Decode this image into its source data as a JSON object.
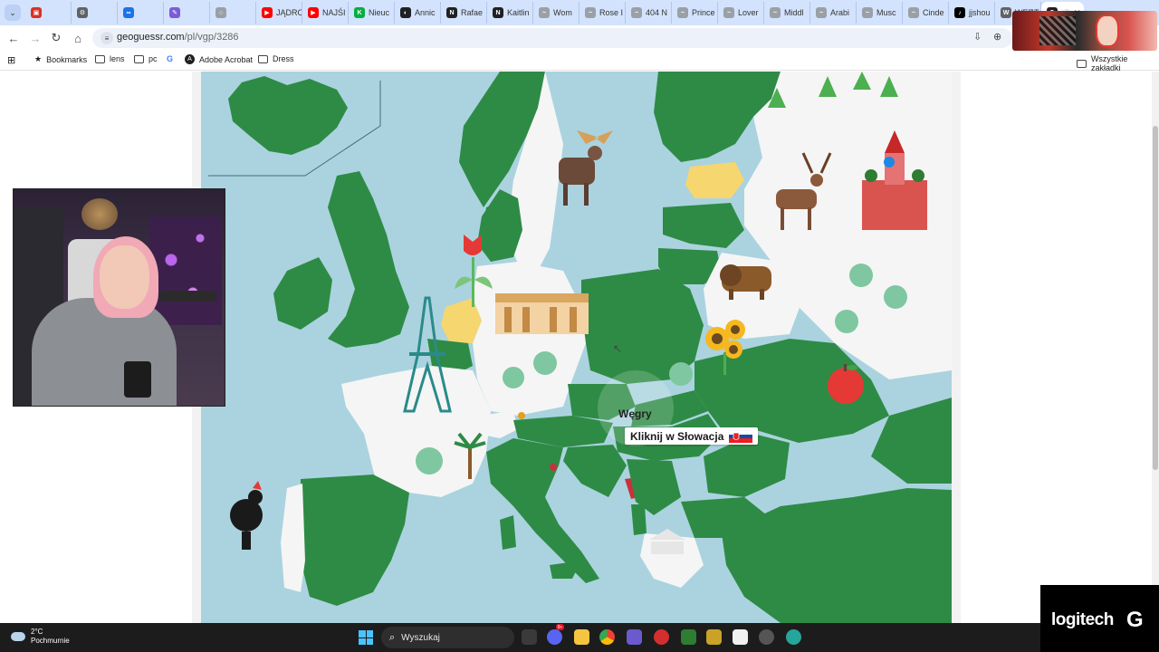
{
  "browser": {
    "tabs": [
      {
        "label": "",
        "fav_color": "#d93025",
        "fav_glyph": "▣"
      },
      {
        "label": "",
        "fav_color": "#5f6368",
        "fav_glyph": "⚙"
      },
      {
        "label": "",
        "fav_color": "#1a73e8",
        "fav_glyph": "∞"
      },
      {
        "label": "",
        "fav_color": "#7b5cd6",
        "fav_glyph": "✎"
      },
      {
        "label": "",
        "fav_color": "#9aa0a6",
        "fav_glyph": "○"
      },
      {
        "label": "JĄDRO",
        "fav_color": "#ff0000",
        "fav_glyph": "▶"
      },
      {
        "label": "NAJŚI",
        "fav_color": "#ff0000",
        "fav_glyph": "▶"
      },
      {
        "label": "Nieuc",
        "fav_color": "#00b140",
        "fav_glyph": "K"
      },
      {
        "label": "Annic",
        "fav_color": "#202124",
        "fav_glyph": "◐"
      },
      {
        "label": "Rafae",
        "fav_color": "#202124",
        "fav_glyph": "N"
      },
      {
        "label": "Kaitlin",
        "fav_color": "#202124",
        "fav_glyph": "N"
      },
      {
        "label": "Wom",
        "fav_color": "#9aa0a6",
        "fav_glyph": "~"
      },
      {
        "label": "Rose I",
        "fav_color": "#9aa0a6",
        "fav_glyph": "~"
      },
      {
        "label": "404 N",
        "fav_color": "#9aa0a6",
        "fav_glyph": "~"
      },
      {
        "label": "Prince",
        "fav_color": "#9aa0a6",
        "fav_glyph": "~"
      },
      {
        "label": "Lover",
        "fav_color": "#9aa0a6",
        "fav_glyph": "~"
      },
      {
        "label": "Middl",
        "fav_color": "#9aa0a6",
        "fav_glyph": "~"
      },
      {
        "label": "Arabi",
        "fav_color": "#9aa0a6",
        "fav_glyph": "~"
      },
      {
        "label": "Musc",
        "fav_color": "#9aa0a6",
        "fav_glyph": "~"
      },
      {
        "label": "Cinde",
        "fav_color": "#9aa0a6",
        "fav_glyph": "~"
      },
      {
        "label": "jjshou",
        "fav_color": "#000000",
        "fav_glyph": "♪"
      },
      {
        "label": "WEDT",
        "fav_color": "#5f6368",
        "fav_glyph": "W"
      }
    ],
    "active_tab_fav_color": "#202124",
    "url_domain": "geoguessr.com",
    "url_path": "/pl/vgp/3286",
    "bookmarks": [
      {
        "label": "Bookmarks",
        "icon": "star-icon"
      },
      {
        "label": "lens",
        "icon": "folder-icon"
      },
      {
        "label": "pc",
        "icon": "folder-icon"
      },
      {
        "label": "",
        "icon": "google-icon"
      },
      {
        "label": "Adobe Acrobat",
        "icon": "acrobat-icon"
      },
      {
        "label": "Dress",
        "icon": "folder-icon"
      }
    ],
    "all_bookmarks_label": "Wszystkie zakładki"
  },
  "game": {
    "hover_country": "Węgry",
    "prompt": "Kliknij w Słowacja",
    "target_flag": "slovakia-flag",
    "colors": {
      "sea": "#aad3df",
      "done": "#2e8b45",
      "neutral": "#f5f5f5",
      "wrong": "#f6d66e",
      "missed": "#c8323c"
    }
  },
  "taskbar": {
    "temp": "2°C",
    "weather": "Pochmurnie",
    "search_label": "Wyszukaj"
  },
  "overlay": {
    "brand": "logitech"
  }
}
